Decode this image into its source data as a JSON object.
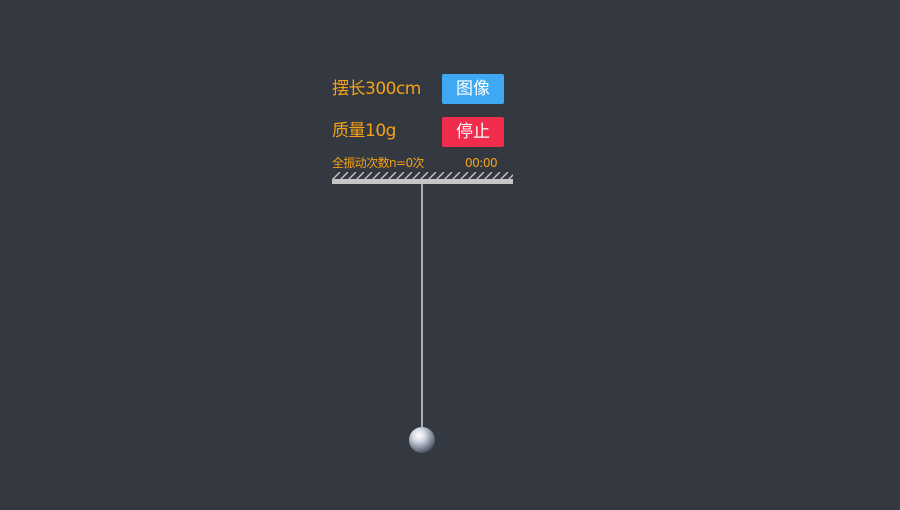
{
  "controls": {
    "length_label": "摆长300cm",
    "mass_label": "质量10g",
    "graph_button": "图像",
    "stop_button": "停止"
  },
  "status": {
    "vibration_count": "全振动次数n=0次",
    "timer": "00:00"
  },
  "colors": {
    "background": "#343840",
    "label_text": "#f5a217",
    "graph_button": "#3fa8f3",
    "stop_button": "#f12b4b",
    "string": "#c8ccd2",
    "ceiling": "#c6c6c6"
  }
}
